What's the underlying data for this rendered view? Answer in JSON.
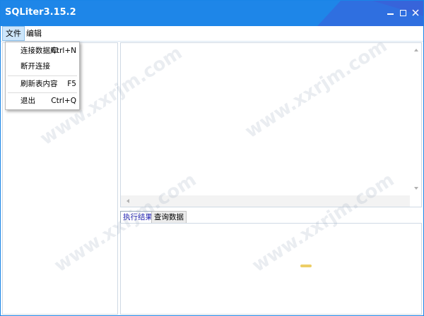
{
  "window": {
    "title": "SQLiter3.15.2",
    "controls": [
      "minimize-icon",
      "maximize-icon",
      "close-icon"
    ],
    "title_color": "#1e86e8"
  },
  "menubar": {
    "items": [
      {
        "label": "文件"
      },
      {
        "label": "编辑"
      }
    ]
  },
  "file_menu": {
    "items": [
      {
        "label": "连接数据库",
        "shortcut": "Ctrl+N"
      },
      {
        "label": "断开连接",
        "shortcut": ""
      },
      {
        "label": "刷新表内容",
        "shortcut": "F5"
      },
      {
        "label": "退出",
        "shortcut": "Ctrl+Q"
      }
    ]
  },
  "result_tabs": [
    {
      "label": "执行结果",
      "active": true
    },
    {
      "label": "查询数据",
      "active": false
    }
  ],
  "watermark": "www.xxrjm.com"
}
